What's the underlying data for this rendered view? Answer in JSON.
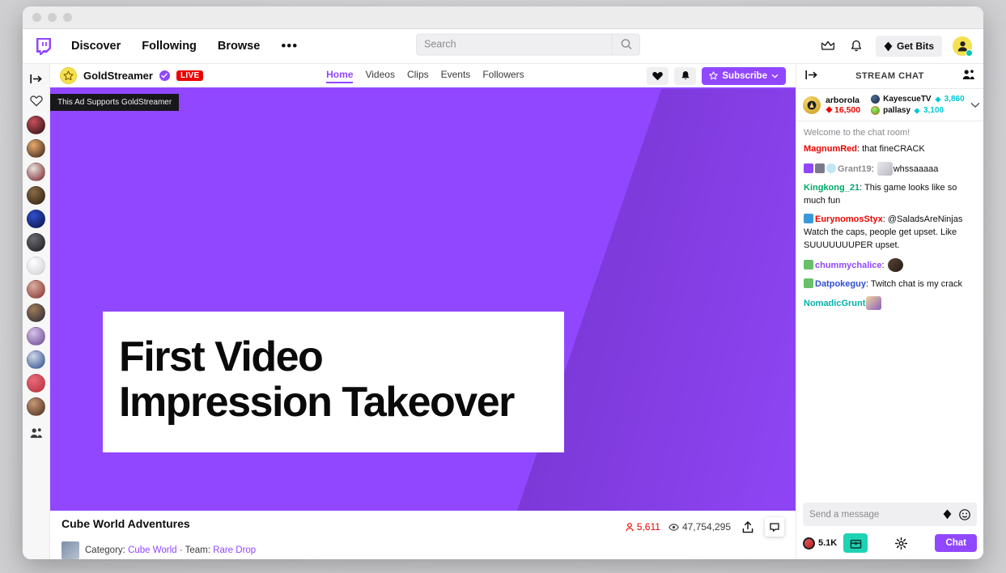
{
  "window": {
    "dots": 3
  },
  "topnav": {
    "logo_icon": "twitch-logo-icon",
    "links": [
      {
        "label": "Discover"
      },
      {
        "label": "Following"
      },
      {
        "label": "Browse"
      }
    ],
    "more_label": "•••",
    "search": {
      "placeholder": "Search",
      "icon": "search-icon"
    },
    "crown_icon": "crown-icon",
    "bell_icon": "bell-icon",
    "bits": {
      "label": "Get Bits",
      "icon": "bits-diamond-icon"
    },
    "avatar_icon": "user-avatar-icon"
  },
  "rail": {
    "collapse_icon": "expand-sidebar-icon",
    "heart_icon": "heart-icon",
    "community_icon": "community-icon",
    "avatars": [
      {
        "name": "channel-1",
        "color1": "#c8505a",
        "color2": "#2a1014"
      },
      {
        "name": "channel-2",
        "color1": "#e8a96b",
        "color2": "#3a241a"
      },
      {
        "name": "channel-3",
        "color1": "#e8e2dc",
        "color2": "#7a1f28"
      },
      {
        "name": "channel-4",
        "color1": "#8a6a44",
        "color2": "#2e2016"
      },
      {
        "name": "channel-5",
        "color1": "#2f4fd0",
        "color2": "#0c1440"
      },
      {
        "name": "channel-6",
        "color1": "#6a6a72",
        "color2": "#1d1d20"
      },
      {
        "name": "channel-7",
        "color1": "#ffffff",
        "color2": "#cfcfd6"
      },
      {
        "name": "channel-8",
        "color1": "#d8b0a0",
        "color2": "#8a2f2f"
      },
      {
        "name": "channel-9",
        "color1": "#9e7a5a",
        "color2": "#2a2a35"
      },
      {
        "name": "channel-10",
        "color1": "#d7c2e8",
        "color2": "#6a4a92"
      },
      {
        "name": "channel-11",
        "color1": "#cfd8ea",
        "color2": "#2f4e8a"
      },
      {
        "name": "channel-12",
        "color1": "#e86a78",
        "color2": "#b8303f"
      },
      {
        "name": "channel-13",
        "color1": "#c89878",
        "color2": "#4a2e1e"
      }
    ]
  },
  "channel": {
    "avatar_icon": "gold-star-avatar-icon",
    "name": "GoldStreamer",
    "verified_icon": "verified-check-icon",
    "live_label": "LIVE",
    "tabs": [
      {
        "label": "Home",
        "active": true
      },
      {
        "label": "Videos",
        "active": false
      },
      {
        "label": "Clips",
        "active": false
      },
      {
        "label": "Events",
        "active": false
      },
      {
        "label": "Followers",
        "active": false
      }
    ],
    "heart_icon": "heart-filled-icon",
    "bell_icon": "bell-icon",
    "subscribe": {
      "label": "Subscribe",
      "icon": "star-icon",
      "chevron": "chevron-down-icon"
    }
  },
  "video": {
    "ad_tag": "This Ad Supports GoldStreamer",
    "ad_headline_line1": "First Video",
    "ad_headline_line2": "Impression Takeover",
    "bg_dark": "#3a1b63",
    "bg_bright": "#9147ff"
  },
  "info": {
    "title": "Cube World Adventures",
    "viewers": "5,611",
    "viewers_icon": "viewer-icon",
    "views": "47,754,295",
    "views_icon": "eye-icon",
    "share_icon": "share-icon",
    "clip_icon": "clip-icon",
    "category_label": "Category:",
    "category_value": "Cube World",
    "separator": "·",
    "team_label": "Team:",
    "team_value": "Rare Drop"
  },
  "chat": {
    "collapse_icon": "collapse-chat-icon",
    "title": "STREAM CHAT",
    "community_icon": "community-icon",
    "leaderboard": {
      "top": {
        "name": "arborola",
        "score": "16,500",
        "icon": "gem-red-icon"
      },
      "others": [
        {
          "name": "KayescueTV",
          "score": "3,860",
          "color": "#2b3a55"
        },
        {
          "name": "pallasy",
          "score": "3,100",
          "color": "#6ee04a"
        }
      ],
      "chevron_icon": "chevron-down-icon"
    },
    "system_message": "Welcome to the chat room!",
    "messages": [
      {
        "user": "MagnumRed",
        "color": "#eb0400",
        "text": "that fineCRACK",
        "badges": [],
        "emotes": []
      },
      {
        "user": "Grant19",
        "color": "#8b8b90",
        "text": "whssaaaaa",
        "badges": [
          "#9147ff",
          "#7a7a8c",
          "#bfe6f5"
        ],
        "emote": "plain"
      },
      {
        "user": "Kingkong_21",
        "color": "#00a86b",
        "text": "This game looks like so much fun",
        "badges": []
      },
      {
        "user": "EurynomosStyx",
        "color": "#eb0400",
        "text": "@SaladsAreNinjas Watch the caps, people get upset. Like SUUUUUUUPER upset.",
        "badges": [
          "#3a9ad9"
        ]
      },
      {
        "user": "chummychalice",
        "color": "#9147ff",
        "text": "",
        "badges": [
          "#6abf69"
        ],
        "emote": "dark"
      },
      {
        "user": "Datpokeguy",
        "color": "#2f4fd0",
        "text": "Twitch chat is my crack",
        "badges": [
          "#6abf69"
        ]
      },
      {
        "user": "NomadicGrunt",
        "color": "#00b2a9",
        "text": "",
        "badges": [],
        "emote": "pk"
      }
    ],
    "input_placeholder": "Send a message",
    "bits_icon": "bits-diamond-icon",
    "emoji_icon": "emoji-smiley-icon",
    "points_value": "5.1K",
    "points_icon": "channel-points-icon",
    "chest_icon": "chest-icon",
    "settings_icon": "gear-icon",
    "chat_button_label": "Chat"
  }
}
